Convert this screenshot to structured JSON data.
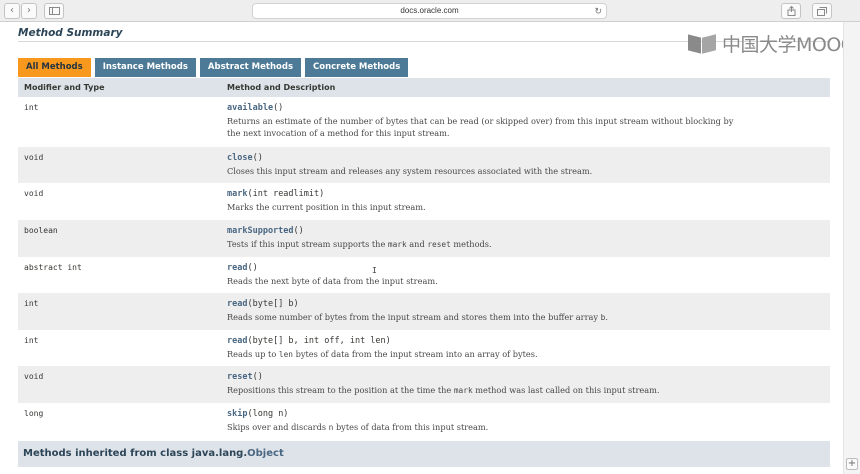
{
  "browser": {
    "url": "docs.oracle.com",
    "back_icon": "chevron-left-icon",
    "forward_icon": "chevron-right-icon",
    "sidebar_icon": "sidebar-icon",
    "reload_icon": "reload-icon",
    "share_icon": "share-icon",
    "tabs_icon": "tabs-icon",
    "new_tab_label": "+"
  },
  "watermark": {
    "text": "中国大学MOOC"
  },
  "page": {
    "summary_title": "Method Summary",
    "tabs": [
      {
        "label": "All Methods",
        "active": true
      },
      {
        "label": "Instance Methods",
        "active": false
      },
      {
        "label": "Abstract Methods",
        "active": false
      },
      {
        "label": "Concrete Methods",
        "active": false
      }
    ],
    "table": {
      "headers": [
        "Modifier and Type",
        "Method and Description"
      ],
      "rows": [
        {
          "type": "int",
          "name": "available",
          "params": "()",
          "desc": [
            "Returns an estimate of the number of bytes that can be read (or skipped over) from this input stream without blocking by",
            "the next invocation of a method for this input stream."
          ]
        },
        {
          "type": "void",
          "name": "close",
          "params": "()",
          "desc": [
            "Closes this input stream and releases any system resources associated with the stream."
          ]
        },
        {
          "type": "void",
          "name": "mark",
          "params": "(int readlimit)",
          "desc": [
            "Marks the current position in this input stream."
          ]
        },
        {
          "type": "boolean",
          "name": "markSupported",
          "params": "()",
          "desc_parts": [
            "Tests if this input stream supports the ",
            "mark",
            " and ",
            "reset",
            " methods."
          ]
        },
        {
          "type": "abstract int",
          "name": "read",
          "params": "()",
          "desc": [
            "Reads the next byte of data from the input stream."
          ]
        },
        {
          "type": "int",
          "name": "read",
          "params": "(byte[] b)",
          "desc_parts": [
            "Reads some number of bytes from the input stream and stores them into the buffer array ",
            "b",
            "."
          ]
        },
        {
          "type": "int",
          "name": "read",
          "params": "(byte[] b, int off, int len)",
          "desc_parts": [
            "Reads up to ",
            "len",
            " bytes of data from the input stream into an array of bytes."
          ]
        },
        {
          "type": "void",
          "name": "reset",
          "params": "()",
          "desc_parts": [
            "Repositions this stream to the position at the time the ",
            "mark",
            " method was last called on this input stream."
          ]
        },
        {
          "type": "long",
          "name": "skip",
          "params": "(long n)",
          "desc_parts": [
            "Skips over and discards ",
            "n",
            " bytes of data from this input stream."
          ]
        }
      ]
    },
    "inherited": {
      "prefix": "Methods inherited from class java.lang.",
      "link": "Object"
    }
  }
}
